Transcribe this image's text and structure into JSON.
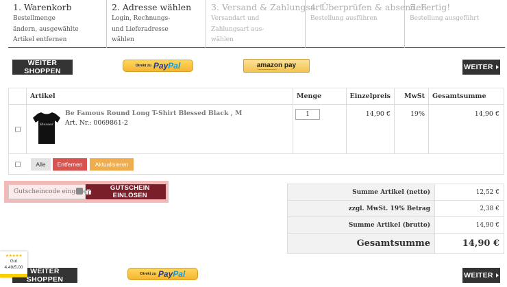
{
  "steps": [
    {
      "title": "1. Warenkorb",
      "desc": [
        "Bestellmenge",
        "ändern, ausgewählte",
        "Artikel entfernen"
      ],
      "active": true,
      "width": 144
    },
    {
      "title": "2. Adresse wählen",
      "desc": [
        "Login, Rechnungs-",
        "und Lieferadresse",
        "wählen"
      ],
      "active": true,
      "width": 145
    },
    {
      "title": "3. Versand & Zahlungsart",
      "desc": [
        "Versandart und",
        "Zahlungsart aus-",
        "wählen"
      ],
      "active": false,
      "width": 145
    },
    {
      "title": "4. Überprüfen & absenden",
      "desc": [
        "Bestellung ausführen"
      ],
      "active": false,
      "width": 145
    },
    {
      "title": "5. Fertig!",
      "desc": [
        "Bestellung ausgeführt"
      ],
      "active": false,
      "width": 146
    }
  ],
  "top_buttons": {
    "continue_shopping": "WEITER SHOPPEN",
    "next": "WEITER"
  },
  "paypal": {
    "prefix": "Direkt zu",
    "word1": "Pay",
    "word2": "Pal"
  },
  "amazon": {
    "label": "amazon pay"
  },
  "cart": {
    "columns": [
      "Artikel",
      "Menge",
      "Einzelpreis",
      "MwSt",
      "Gesamtsumme"
    ],
    "item": {
      "name": "Be Famous Round Long T-Shirt Blessed Black , M",
      "sku": "Art. Nr.: 0069861-2",
      "quantity": "1",
      "unit_price": "14,90 €",
      "vat": "19%",
      "total": "14,90 €",
      "shirt_text": "Blessed"
    },
    "actions": {
      "all": "Alle",
      "remove": "Entfernen",
      "update": "Aktualisieren"
    }
  },
  "voucher": {
    "placeholder": "Gutscheincode eingeben",
    "button": "GUTSCHEIN EINLÖSEN"
  },
  "totals": [
    {
      "label": "Summe Artikel (netto)",
      "value": "12,52 €"
    },
    {
      "label": "zzgl. MwSt. 19% Betrag",
      "value": "2,38 €"
    },
    {
      "label": "Summe Artikel (brutto)",
      "value": "14,90 €"
    },
    {
      "label": "Gesamtsumme",
      "value": "14,90 €"
    }
  ],
  "rating_badge": {
    "stars": "★★★★★",
    "label": "Gut",
    "score": "4.49/5.00"
  },
  "colors": {
    "dark_button": "#333333",
    "remove_button": "#d9534f",
    "update_button": "#f0ad4e",
    "voucher_button": "#7a1f2a",
    "voucher_highlight": "#f3b9b9"
  }
}
